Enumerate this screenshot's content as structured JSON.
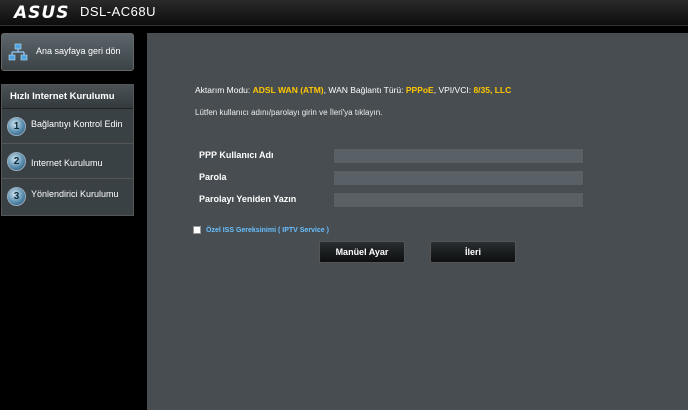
{
  "header": {
    "brand": "ASUS",
    "model": "DSL-AC68U"
  },
  "sidebar": {
    "home_label": "Ana sayfaya geri dön",
    "section_title": "Hızlı Internet Kurulumu",
    "items": [
      {
        "num": "1",
        "label": "Bağlantıyı Kontrol Edin"
      },
      {
        "num": "2",
        "label": "Internet Kurulumu"
      },
      {
        "num": "3",
        "label": "Yönlendirici Kurulumu"
      }
    ]
  },
  "main": {
    "info": {
      "mode_label": "Aktarım Modu:",
      "mode_value": "ADSL WAN (ATM)",
      "wan_label": ", WAN Bağlantı Türü:",
      "wan_value": "PPPoE",
      "vpi_label": ", VPI/VCI:",
      "vpi_value": "8/35, LLC"
    },
    "instruction": "Lütfen kullanıcı adını/parolayı girin ve İleri'ya tıklayın.",
    "fields": [
      {
        "label": "PPP Kullanıcı Adı",
        "value": ""
      },
      {
        "label": "Parola",
        "value": ""
      },
      {
        "label": "Parolayı Yeniden Yazın",
        "value": ""
      }
    ],
    "special_isp_label": "Özel ISS Gereksinimi ( IPTV Service )",
    "buttons": {
      "manual": "Manüel Ayar",
      "next": "İleri"
    }
  },
  "colors": {
    "highlight": "#ffc600",
    "link": "#69c0ff",
    "panel": "#474d51"
  }
}
